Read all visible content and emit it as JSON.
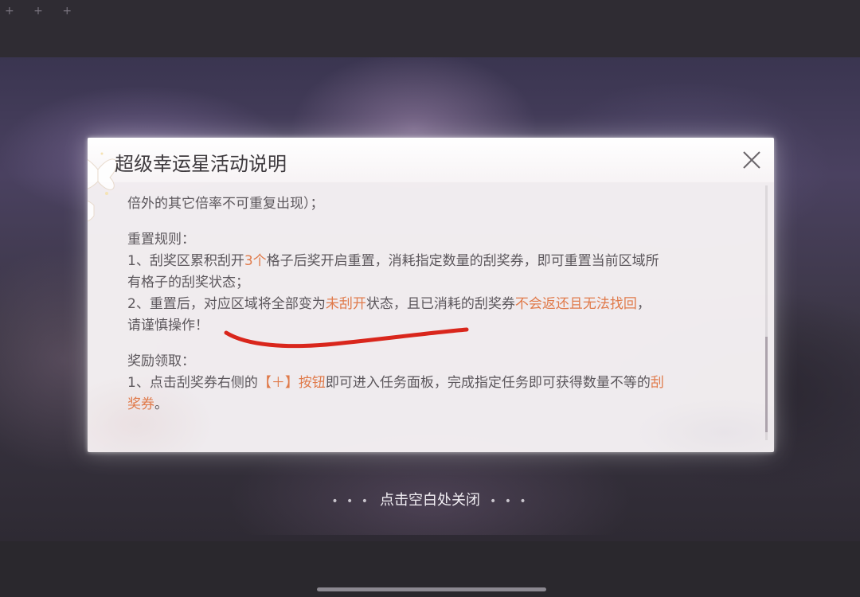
{
  "background": {
    "decoration": "+ + +"
  },
  "dialog": {
    "title": "超级幸运星活动说明",
    "close_icon": "close-icon",
    "paragraphs": {
      "p0": "倍外的其它倍率不可重复出现）；",
      "reset_heading": "重置规则：",
      "reset1_a": "1、刮奖区累积刮开",
      "reset1_hl": "3个",
      "reset1_b": "格子后奖开启重置，消耗指定数量的刮奖券，即可重置当前区域所",
      "reset1_c": "有格子的刮奖状态；",
      "reset2_a": "2、重置后，对应区域将全部变为",
      "reset2_hl1": "未刮开",
      "reset2_b": "状态，且已消耗的刮奖券",
      "reset2_hl2": "不会返还且无法找回",
      "reset2_c": "，",
      "reset2_d": "请谨慎操作！",
      "reward_heading": "奖励领取：",
      "reward1_a": "1、点击刮奖券右侧的",
      "reward1_hl1": "【＋】按钮",
      "reward1_b": "即可进入任务面板，完成指定任务即可获得数量不等的",
      "reward1_hl2": "刮",
      "reward1_c": "奖券",
      "reward1_d": "。"
    },
    "highlight_color": "#e07a4a"
  },
  "hint": {
    "dots_left": "• • •",
    "text": "点击空白处关闭",
    "dots_right": "• • •"
  },
  "annotation_color": "#d9261c"
}
